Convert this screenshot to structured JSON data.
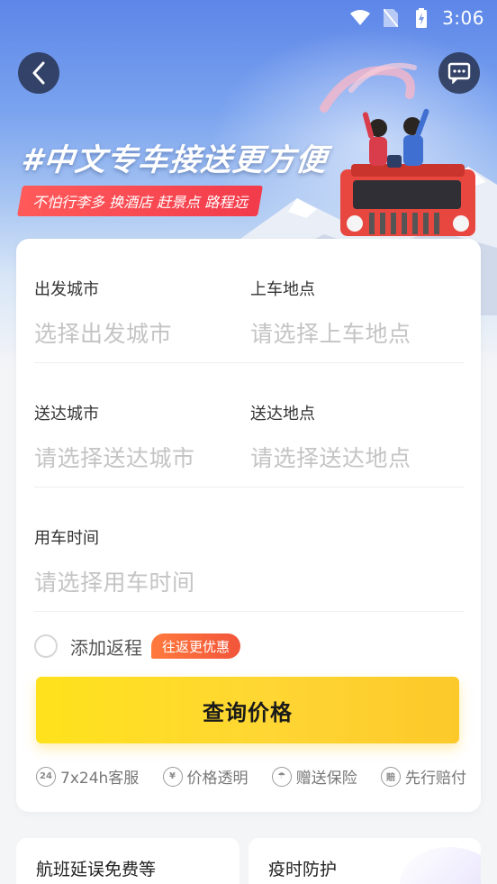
{
  "status_bar": {
    "time": "3:06"
  },
  "hero": {
    "title": "#中文专车接送更方便",
    "tagline": "不怕行李多 换酒店 赶景点 路程远"
  },
  "form": {
    "departure_city": {
      "label": "出发城市",
      "placeholder": "选择出发城市"
    },
    "pickup_location": {
      "label": "上车地点",
      "placeholder": "请选择上车地点"
    },
    "destination_city": {
      "label": "送达城市",
      "placeholder": "请选择送达城市"
    },
    "dropoff_location": {
      "label": "送达地点",
      "placeholder": "请选择送达地点"
    },
    "use_time": {
      "label": "用车时间",
      "placeholder": "请选择用车时间"
    },
    "return_trip": {
      "label": "添加返程",
      "badge": "往返更优惠"
    },
    "query_button": "查询价格"
  },
  "features": [
    {
      "icon": "24h-service-icon",
      "icon_text": "24",
      "label": "7x24h客服"
    },
    {
      "icon": "yen-icon",
      "icon_text": "¥",
      "label": "价格透明"
    },
    {
      "icon": "insurance-umbrella-icon",
      "icon_text": "☂",
      "label": "赠送保险"
    },
    {
      "icon": "compensation-icon",
      "icon_text": "赔",
      "label": "先行赔付"
    }
  ],
  "bottom_cards": [
    {
      "title": "航班延误免费等"
    },
    {
      "title": "疫时防护"
    }
  ],
  "colors": {
    "accent_yellow": "#ffd633",
    "badge_orange": "#f2553b",
    "tag_red": "#f23b4b",
    "placeholder": "#c4c4c4"
  }
}
